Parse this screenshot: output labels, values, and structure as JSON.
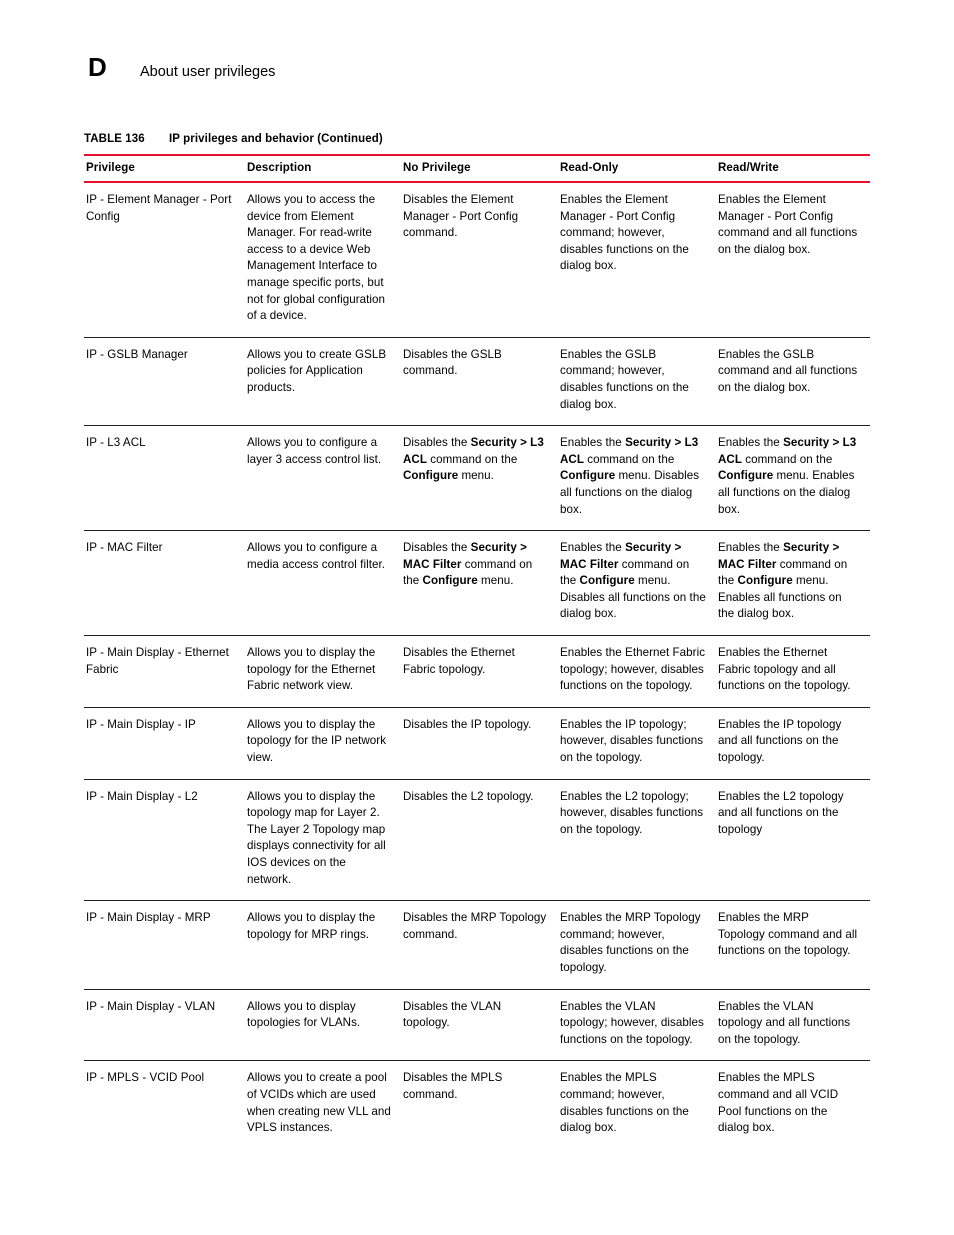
{
  "page": {
    "appendix_letter": "D",
    "running_head": "About user privileges"
  },
  "table": {
    "caption_label": "TABLE 136",
    "caption_text": "IP privileges and behavior (Continued)",
    "accent_color": "#e8112d",
    "rule_color": "#231f20",
    "columns": [
      "Privilege",
      "Description",
      "No Privilege",
      "Read-Only",
      "Read/Write"
    ],
    "rows": [
      {
        "privilege": "IP - Element Manager - Port Config",
        "description": "Allows you to access the device from Element Manager. For read-write access to a device Web Management Interface to manage specific ports, but not for global configuration of a device.",
        "no_privilege": "Disables the Element Manager - Port Config command.",
        "read_only": "Enables the Element Manager - Port Config command; however, disables functions on the dialog box.",
        "read_write": "Enables the Element Manager - Port Config command and all functions on the dialog box."
      },
      {
        "privilege": "IP - GSLB Manager",
        "description": "Allows you to create GSLB policies for Application products.",
        "no_privilege": "Disables the GSLB command.",
        "read_only": "Enables the GSLB command; however, disables functions on the dialog box.",
        "read_write": "Enables the GSLB command and all functions on the dialog box."
      },
      {
        "privilege": "IP - L3 ACL",
        "description": "Allows you to configure a layer 3 access control list.",
        "no_privilege_html": "Disables the <b>Security &gt; L3 ACL</b> command on the <b>Configure</b> menu.",
        "read_only_html": "Enables the <b>Security &gt; L3 ACL</b> command on the <b>Configure</b> menu. Disables all functions on the dialog box.",
        "read_write_html": "Enables the <b>Security &gt; L3 ACL</b> command on the <b>Configure</b> menu. Enables all functions on the dialog box."
      },
      {
        "privilege": "IP - MAC Filter",
        "description": "Allows you to configure a media access control filter.",
        "no_privilege_html": "Disables the <b>Security &gt; MAC Filter</b> command on the <b>Configure</b> menu.",
        "read_only_html": "Enables the <b>Security &gt; MAC Filter</b> command on the <b>Configure</b> menu. Disables all functions on the dialog box.",
        "read_write_html": "Enables the <b>Security &gt; MAC Filter</b> command on the <b>Configure</b> menu. Enables all functions on the dialog box."
      },
      {
        "privilege": "IP - Main Display - Ethernet Fabric",
        "description": "Allows you to display the topology for the Ethernet Fabric network view.",
        "no_privilege": "Disables the Ethernet Fabric topology.",
        "read_only": "Enables the Ethernet Fabric topology; however, disables functions on the topology.",
        "read_write": "Enables the Ethernet Fabric topology and all functions on the topology."
      },
      {
        "privilege": "IP - Main Display - IP",
        "description": "Allows you to display the topology for the IP network view.",
        "no_privilege": "Disables the IP topology.",
        "read_only": "Enables the IP topology; however, disables functions on the topology.",
        "read_write": "Enables the IP topology and all functions on the topology."
      },
      {
        "privilege": "IP - Main Display - L2",
        "description": "Allows you to display the topology map for Layer 2. The Layer 2 Topology map displays connectivity for all IOS devices on the network.",
        "no_privilege": "Disables the L2 topology.",
        "read_only": "Enables the L2 topology; however, disables functions on the topology.",
        "read_write": "Enables the L2 topology and all functions on the topology"
      },
      {
        "privilege": "IP - Main Display - MRP",
        "description": "Allows you to display the topology for MRP rings.",
        "no_privilege": "Disables the MRP Topology command.",
        "read_only": "Enables the MRP Topology command; however, disables functions on the topology.",
        "read_write": "Enables the MRP Topology command and all functions on the topology."
      },
      {
        "privilege": "IP - Main Display - VLAN",
        "description": "Allows you to display topologies for VLANs.",
        "no_privilege": "Disables the VLAN topology.",
        "read_only": "Enables the VLAN topology; however, disables functions on the topology.",
        "read_write": "Enables the VLAN topology and all functions on the topology."
      },
      {
        "privilege": "IP - MPLS - VCID Pool",
        "description": "Allows you to create a pool of VCIDs which are used when creating new VLL and VPLS instances.",
        "no_privilege": "Disables the MPLS command.",
        "read_only": "Enables the MPLS command; however, disables functions on the dialog box.",
        "read_write": "Enables the MPLS command and all VCID Pool functions on the dialog box."
      }
    ]
  }
}
